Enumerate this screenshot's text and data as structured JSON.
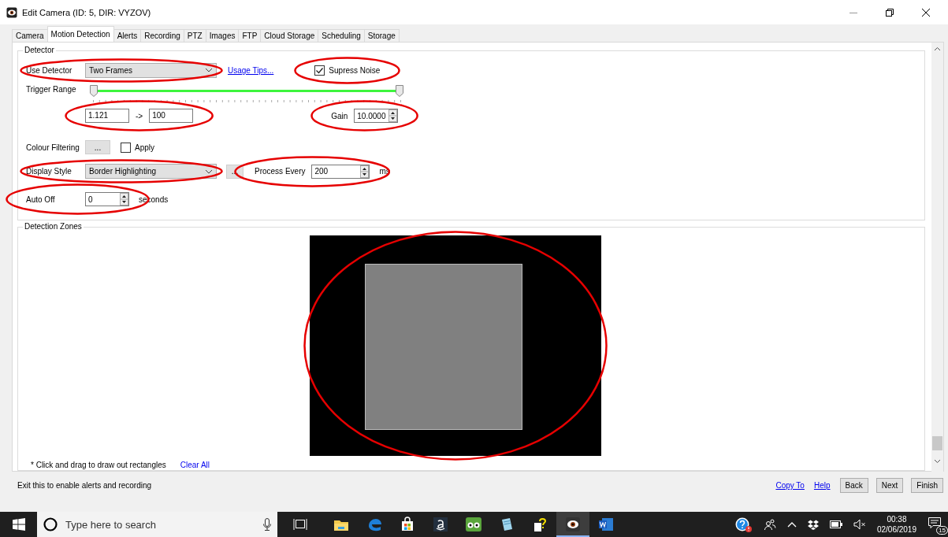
{
  "window": {
    "title": "Edit Camera (ID: 5, DIR: VYZOV)"
  },
  "tabs": [
    {
      "label": "Camera",
      "selected": false
    },
    {
      "label": "Motion Detection",
      "selected": true
    },
    {
      "label": "Alerts",
      "selected": false
    },
    {
      "label": "Recording",
      "selected": false
    },
    {
      "label": "PTZ",
      "selected": false
    },
    {
      "label": "Images",
      "selected": false
    },
    {
      "label": "FTP",
      "selected": false
    },
    {
      "label": "Cloud Storage",
      "selected": false
    },
    {
      "label": "Scheduling",
      "selected": false
    },
    {
      "label": "Storage",
      "selected": false
    }
  ],
  "detector": {
    "title": "Detector",
    "use_detector": {
      "label": "Use Detector",
      "value": "Two Frames",
      "circled": true
    },
    "usage_tips": {
      "label": "Usage Tips..."
    },
    "supress_noise": {
      "label": "Supress Noise",
      "checked": true,
      "circled": true
    },
    "trigger_range": {
      "label": "Trigger Range",
      "thumbs": [
        {
          "level": 0
        },
        {
          "level": 1
        }
      ],
      "min": "1.121",
      "arrow": "->",
      "max": "100",
      "circled": true
    },
    "gain": {
      "label": "Gain",
      "value": "10.0000",
      "circled": true
    },
    "colour_filtering": {
      "label": "Colour Filtering",
      "button": "...",
      "apply": {
        "label": "Apply",
        "checked": false
      }
    },
    "display_style": {
      "label": "Display Style",
      "value": "Border Highlighting",
      "button": "...",
      "circled": true
    },
    "process_every": {
      "label": "Process Every",
      "value": "200",
      "unit": "ms",
      "circled": true
    },
    "auto_off": {
      "label": "Auto Off",
      "value": "0",
      "unit": "seconds",
      "circled": true
    }
  },
  "detection_zones": {
    "title": "Detection Zones",
    "zones": [
      {
        "kind": "rectangle"
      }
    ],
    "circled": true,
    "hint": "* Click and drag to draw out rectangles",
    "clear_all": "Clear All"
  },
  "status_bar": {
    "message": "Exit this to enable alerts and recording",
    "links": [
      "Copy To",
      "Help"
    ],
    "buttons": [
      "Back",
      "Next",
      "Finish"
    ]
  },
  "taskbar": {
    "search": {
      "placeholder": "Type here to search"
    },
    "apps": [
      {
        "kind": "folder",
        "selected": false
      },
      {
        "kind": "edge",
        "selected": false
      },
      {
        "kind": "store",
        "selected": false
      },
      {
        "kind": "amazon",
        "selected": false
      },
      {
        "kind": "owl",
        "selected": false
      },
      {
        "kind": "notepad",
        "selected": false
      },
      {
        "kind": "help",
        "selected": false
      },
      {
        "kind": "eye",
        "selected": true
      },
      {
        "kind": "word",
        "selected": false
      }
    ],
    "time": "00:38",
    "date": "02/06/2019",
    "notifications": "15"
  }
}
